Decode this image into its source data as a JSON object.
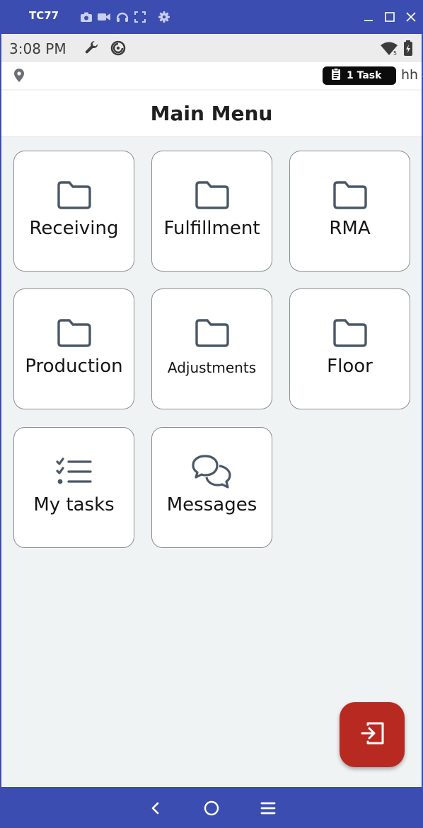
{
  "window": {
    "device_name": "TC77",
    "toolbar_icons": [
      "camera-icon",
      "video-icon",
      "headphones-icon",
      "fullscreen-icon",
      "gear-icon"
    ],
    "controls": [
      "minimize-icon",
      "maximize-icon",
      "close-icon"
    ]
  },
  "status_bar": {
    "time": "3:08 PM",
    "icons": [
      "wrench-icon",
      "sync-icon",
      "wifi-icon",
      "battery-icon"
    ]
  },
  "info_bar": {
    "task_count_label": "1 Task",
    "user_initials": "hh",
    "icons": [
      "location-icon",
      "clipboard-icon"
    ]
  },
  "header": {
    "title": "Main Menu"
  },
  "menu": {
    "items": [
      {
        "label": "Receiving",
        "icon": "folder-icon"
      },
      {
        "label": "Fulfillment",
        "icon": "folder-icon"
      },
      {
        "label": "RMA",
        "icon": "folder-icon"
      },
      {
        "label": "Production",
        "icon": "folder-icon"
      },
      {
        "label": "Adjustments",
        "icon": "folder-icon"
      },
      {
        "label": "Floor",
        "icon": "folder-icon"
      },
      {
        "label": "My tasks",
        "icon": "checklist-icon"
      },
      {
        "label": "Messages",
        "icon": "chat-bubbles-icon"
      }
    ]
  },
  "fab": {
    "icon": "logout-icon"
  },
  "nav_bar": {
    "icons": [
      "back-icon",
      "home-icon",
      "menu-icon"
    ]
  },
  "colors": {
    "window_bar": "#3b4db0",
    "screen_bg": "#f0f3f4",
    "tile_border": "#8a8f93",
    "icon_slate": "#4a5866",
    "fab": "#b82a21",
    "task_pill": "#0c0c0c"
  }
}
